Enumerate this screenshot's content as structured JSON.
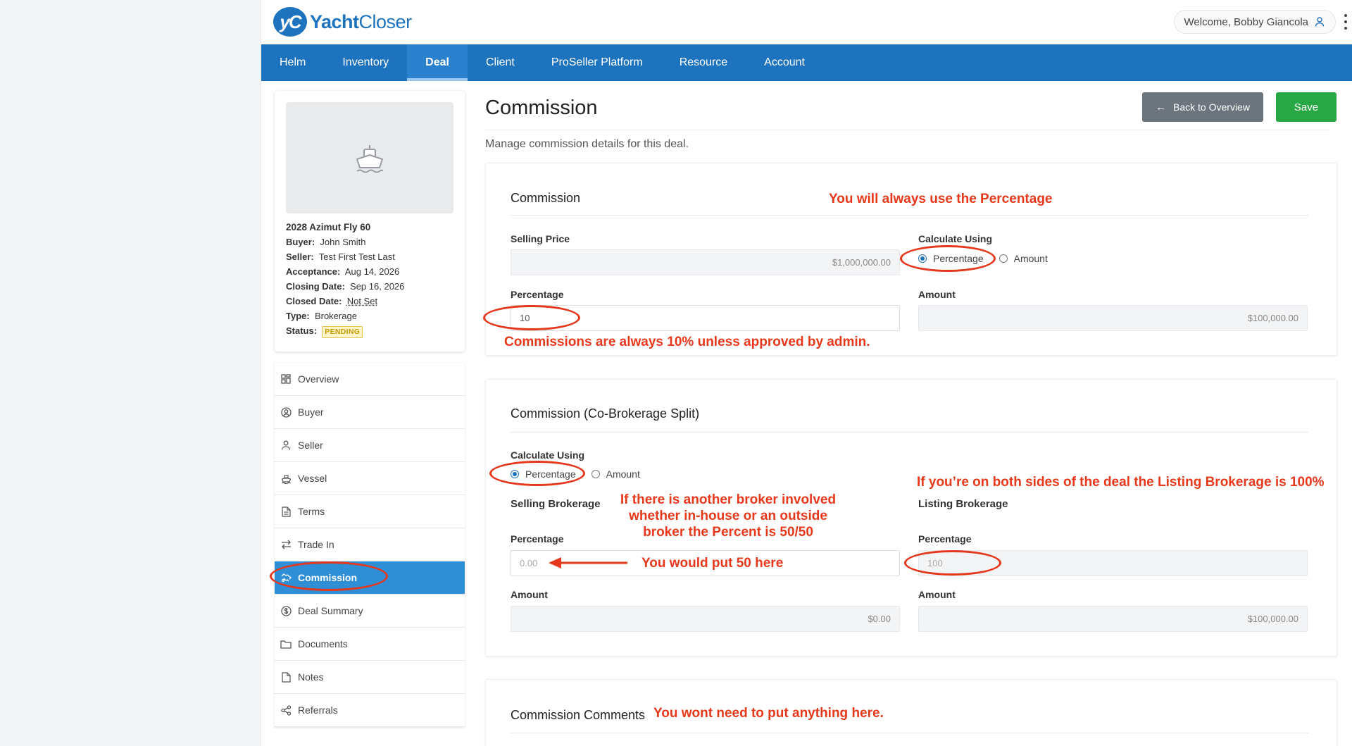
{
  "header": {
    "logo_mark": "yC",
    "logo_text_bold": "Yacht",
    "logo_text_light": "Closer",
    "welcome": "Welcome, Bobby Giancola"
  },
  "nav": {
    "items": [
      {
        "label": "Helm"
      },
      {
        "label": "Inventory"
      },
      {
        "label": "Deal",
        "active": true
      },
      {
        "label": "Client"
      },
      {
        "label": "ProSeller Platform"
      },
      {
        "label": "Resource"
      },
      {
        "label": "Account"
      }
    ]
  },
  "vessel": {
    "name": "2028 Azimut Fly 60",
    "buyer_label": "Buyer:",
    "buyer": "John Smith",
    "seller_label": "Seller:",
    "seller": "Test First Test Last",
    "acceptance_label": "Acceptance:",
    "acceptance": "Aug 14, 2026",
    "closing_label": "Closing Date:",
    "closing": "Sep 16, 2026",
    "closed_label": "Closed Date:",
    "closed": "Not Set",
    "type_label": "Type:",
    "type": "Brokerage",
    "status_label": "Status:",
    "status": "PENDING"
  },
  "sidebar": {
    "items": [
      {
        "label": "Overview",
        "icon": "grid-icon"
      },
      {
        "label": "Buyer",
        "icon": "user-circle-icon"
      },
      {
        "label": "Seller",
        "icon": "user-icon"
      },
      {
        "label": "Vessel",
        "icon": "ship-icon"
      },
      {
        "label": "Terms",
        "icon": "document-icon"
      },
      {
        "label": "Trade In",
        "icon": "swap-icon"
      },
      {
        "label": "Commission",
        "icon": "handshake-icon",
        "active": true
      },
      {
        "label": "Deal Summary",
        "icon": "dollar-circle-icon"
      },
      {
        "label": "Documents",
        "icon": "folder-icon"
      },
      {
        "label": "Notes",
        "icon": "note-icon"
      },
      {
        "label": "Referrals",
        "icon": "share-icon"
      }
    ]
  },
  "page": {
    "title": "Commission",
    "subtitle": "Manage commission details for this deal.",
    "back_button": "Back to Overview",
    "save_button": "Save"
  },
  "commission": {
    "title": "Commission",
    "selling_price_label": "Selling Price",
    "selling_price": "$1,000,000.00",
    "calc_using_label": "Calculate Using",
    "opt_percentage": "Percentage",
    "opt_amount": "Amount",
    "selected": "Percentage",
    "percentage_label": "Percentage",
    "percentage": "10",
    "amount_label": "Amount",
    "amount": "$100,000.00"
  },
  "cobrokerage": {
    "title": "Commission (Co-Brokerage Split)",
    "calc_using_label": "Calculate Using",
    "opt_percentage": "Percentage",
    "opt_amount": "Amount",
    "selected": "Percentage",
    "selling_heading": "Selling Brokerage",
    "listing_heading": "Listing Brokerage",
    "selling_percentage_label": "Percentage",
    "selling_percentage_placeholder": "0.00",
    "selling_amount_label": "Amount",
    "selling_amount": "$0.00",
    "listing_percentage_label": "Percentage",
    "listing_percentage": "100",
    "listing_amount_label": "Amount",
    "listing_amount": "$100,000.00"
  },
  "comments": {
    "title": "Commission Comments"
  },
  "annotations": {
    "always_percentage": "You will always use the Percentage",
    "ten_percent": "Commissions are always 10% unless approved by admin.",
    "both_sides": "If you’re on both sides of the deal the Listing Brokerage is 100%",
    "other_broker_1": "If there is another broker involved",
    "other_broker_2": "whether in-house or an outside",
    "other_broker_3": "broker the Percent is 50/50",
    "put_50": "You would put 50 here",
    "no_comments": "You wont need to put anything here.",
    "color": "#e8381b"
  },
  "colors": {
    "brand": "#1e73be",
    "save": "#28a745",
    "back": "#6c757d",
    "sidebar_active": "#2e8fd6"
  }
}
